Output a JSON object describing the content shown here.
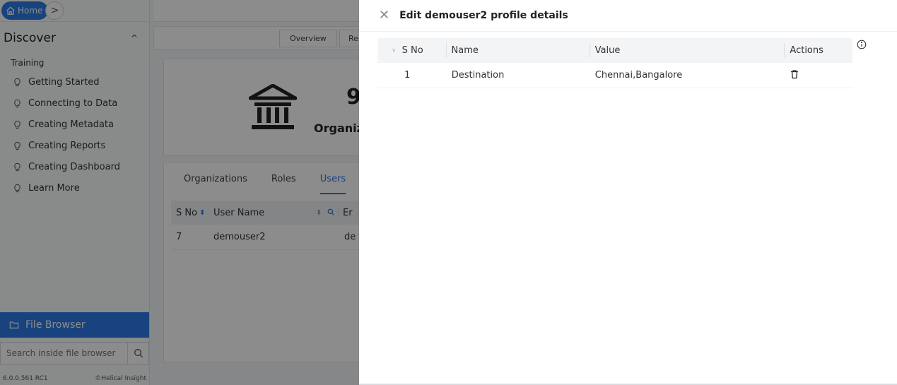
{
  "sidebar": {
    "home_label": "Home",
    "discover_label": "Discover",
    "section_title": "Training",
    "items": [
      {
        "label": "Getting Started"
      },
      {
        "label": "Connecting to Data"
      },
      {
        "label": "Creating Metadata"
      },
      {
        "label": "Creating Reports"
      },
      {
        "label": "Creating Dashboard"
      },
      {
        "label": "Learn More"
      }
    ],
    "file_browser_label": "File Browser",
    "search_placeholder": "Search inside file browser",
    "version": "6.0.0.561 RC1",
    "brand": "©Helical Insight"
  },
  "main": {
    "tabs": [
      {
        "label": "Overview"
      },
      {
        "label": "Re"
      }
    ],
    "stat": {
      "value": "9",
      "label": "Organizat"
    },
    "sub_tabs": [
      {
        "label": "Organizations"
      },
      {
        "label": "Roles"
      },
      {
        "label": "Users"
      }
    ],
    "users_table": {
      "headers": [
        "S No",
        "User Name",
        "Er"
      ],
      "rows": [
        {
          "sno": "7",
          "user": "demouser2",
          "email": "de"
        }
      ]
    }
  },
  "drawer": {
    "title": "Edit demouser2 profile details",
    "headers": {
      "sno": "S No",
      "name": "Name",
      "value": "Value",
      "actions": "Actions"
    },
    "rows": [
      {
        "sno": "1",
        "name": "Destination",
        "value": "Chennai,Bangalore"
      }
    ]
  },
  "colors": {
    "accent": "#2d7be5",
    "overlay": "rgba(0,0,0,0.45)"
  }
}
